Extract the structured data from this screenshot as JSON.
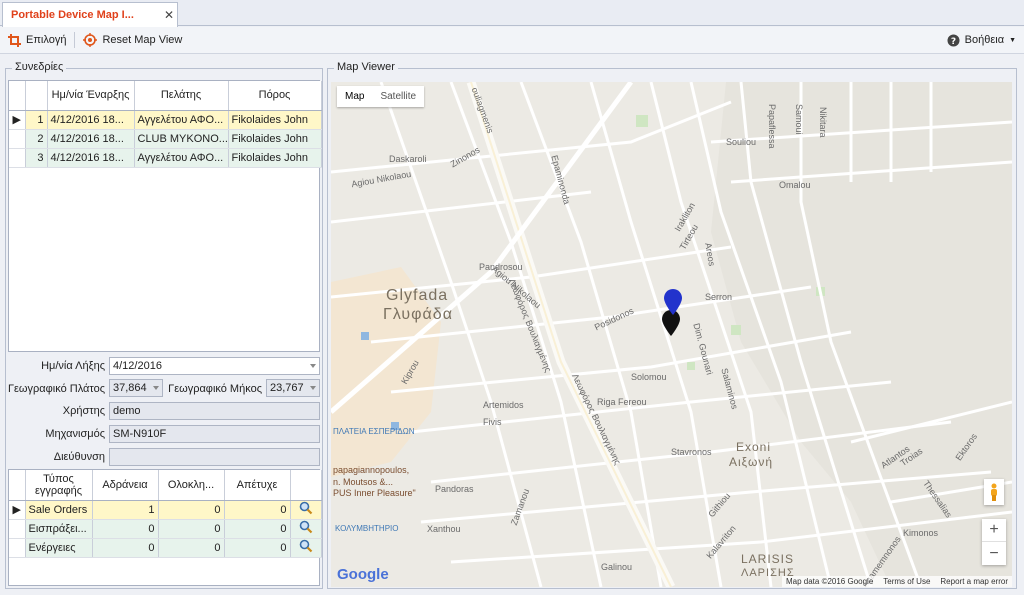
{
  "tab": {
    "title": "Portable Device Map I..."
  },
  "toolbar": {
    "select_label": "Επιλογή",
    "reset_label": "Reset Map View",
    "help_label": "Βοήθεια"
  },
  "sessions": {
    "title": "Συνεδρίες",
    "columns": [
      "Ημ/νία Έναρξης",
      "Πελάτης",
      "Πόρος"
    ],
    "rows": [
      {
        "num": "1",
        "start": "4/12/2016 18...",
        "customer": "Αγγελέτου ΑΦΟ...",
        "resource": "Fikolaides John"
      },
      {
        "num": "2",
        "start": "4/12/2016 18...",
        "customer": "CLUB MYKONO...",
        "resource": "Fikolaides John"
      },
      {
        "num": "3",
        "start": "4/12/2016 18...",
        "customer": "Αγγελέτου ΑΦΟ...",
        "resource": "Fikolaides John"
      }
    ]
  },
  "form": {
    "end_date_label": "Ημ/νία Λήξης",
    "end_date_value": "4/12/2016",
    "lat_label": "Γεωγραφικό Πλάτος",
    "lat_value": "37,864",
    "lon_label": "Γεωγραφικό Μήκος",
    "lon_value": "23,767",
    "user_label": "Χρήστης",
    "user_value": "demo",
    "device_label": "Μηχανισμός",
    "device_value": "SM-N910F",
    "address_label": "Διεύθυνση",
    "address_value": ""
  },
  "records": {
    "columns": [
      "Τύπος εγγραφής",
      "Αδράνεια",
      "Ολοκλη...",
      "Απέτυχε"
    ],
    "rows": [
      {
        "type": "Sale Orders",
        "idle": "1",
        "done": "0",
        "failed": "0"
      },
      {
        "type": "Εισπράξει...",
        "idle": "0",
        "done": "0",
        "failed": "0"
      },
      {
        "type": "Ενέργειες",
        "idle": "0",
        "done": "0",
        "failed": "0"
      }
    ]
  },
  "map": {
    "title": "Map Viewer",
    "toggle_map": "Map",
    "toggle_satellite": "Satellite",
    "google": "Google",
    "footer_data": "Map data ©2016 Google",
    "footer_terms": "Terms of Use",
    "footer_report": "Report a map error",
    "labels": {
      "glyfada": "Glyfada",
      "glyfada_gr": "Γλυφάδα",
      "exoni": "Exoni",
      "exoni_gr": "Αιξωνή",
      "larisis": "LARISIS",
      "larisis_gr": "ΛΑΡΙΣΗΣ",
      "vouliagmenis": "Λεωφόρος Βουλιαγμένης",
      "vouliagmenis2": "Λεωφόρος Βουλιαγμένης",
      "vouliagmenis_top": "ouliagmenis",
      "omalou": "Omalou",
      "serron": "Serron",
      "posidonos": "Posidonos",
      "artemidos": "Artemidos",
      "salaminos": "Salaminos",
      "kiprou": "Kiprou",
      "pandora": "Pandoras",
      "zirinon": "Zinonos",
      "daskaroli": "Daskaroli",
      "agiou_nikolaou": "Agiou Nikolaou",
      "agiou_nikolaou2": "Agiou Nikolaou",
      "solomou": "Solomou",
      "riga_fereou": "Riga Fereou",
      "fivis": "Fivis",
      "xanthou": "Xanthou",
      "kolimvitirio": "ΚΟΛΥΜΒΗΤΗΡΙΟ",
      "platia": "ΠΛΑΤΕΙΑ ΕΣΠΕΡΙΔΩΝ",
      "papagiannopoulos": "papagiannopoulos,",
      "moutsos": "n. Moutsos &...",
      "inner_pleasure": "PUS Inner Pleasure\"",
      "stavronos": "Stavronos",
      "kimonos": "Kimonos",
      "thessalias": "Thessalias",
      "ektoros": "Ektoros",
      "souliou": "Souliou",
      "samoui": "Samoui",
      "nikitara": "Nikitara",
      "papaflessa": "Papaflessa",
      "galini": "Galinou",
      "dim_gounari": "Dim. Gounari",
      "epaminonda": "Epaminonda",
      "irakliton": "Irakliton",
      "tirteou": "Tirteou",
      "ireon": "Areos",
      "panoreou": "Pandrosou",
      "agamemnonos": "Agamemnonos",
      "lithiou": "Githiou",
      "kalavriton": "Kalavriton",
      "zappeiou": "Zamanou",
      "atlantos": "Atlantos",
      "troias": "Troias"
    }
  },
  "colors": {
    "accent": "#e0411b",
    "selected_row": "#fff7c8",
    "alt_row": "#e7f3ec",
    "marker": "#2233cc"
  }
}
